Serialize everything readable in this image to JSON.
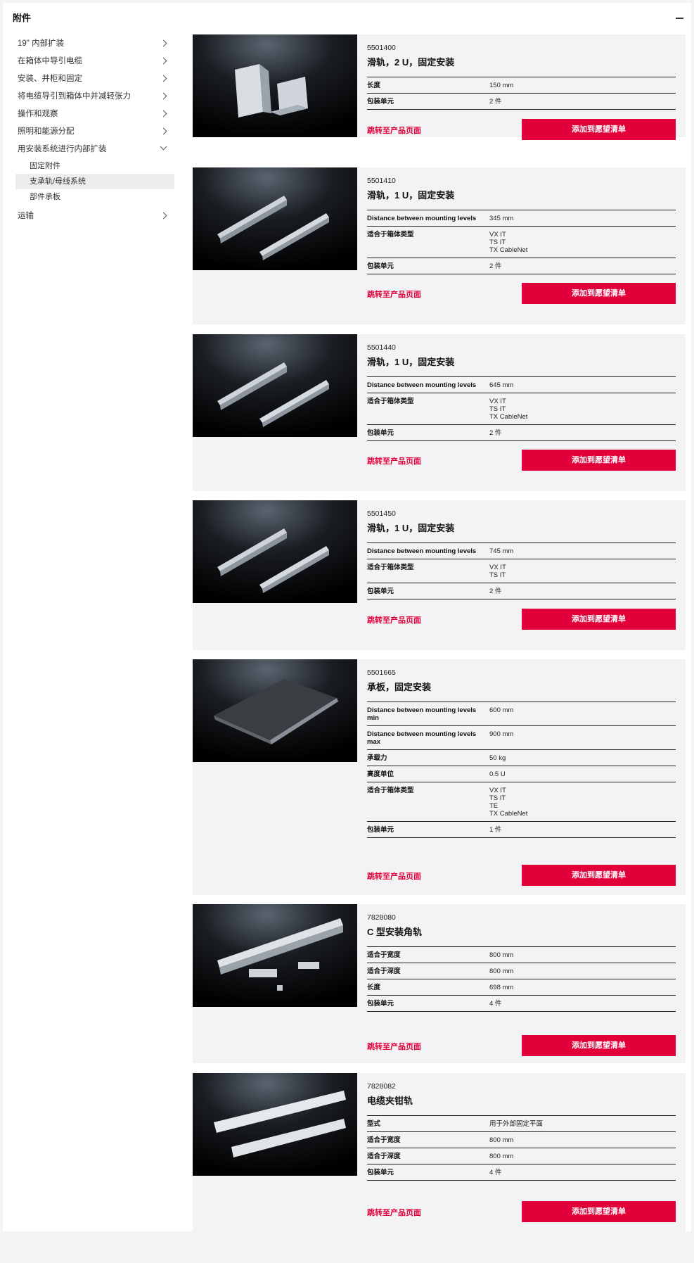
{
  "header": {
    "title": "附件"
  },
  "sidebar": {
    "items": [
      {
        "label": "19\" 内部扩装"
      },
      {
        "label": "在箱体中导引电缆"
      },
      {
        "label": "安装、并柜和固定"
      },
      {
        "label": "将电缆导引到箱体中并减轻张力"
      },
      {
        "label": "操作和观察"
      },
      {
        "label": "照明和能源分配"
      },
      {
        "label": "用安装系统进行内部扩装"
      }
    ],
    "subitems": [
      {
        "label": "固定附件"
      },
      {
        "label": "支承轨/母线系统"
      },
      {
        "label": "部件承板"
      }
    ],
    "last": {
      "label": "运输"
    }
  },
  "actions": {
    "link": "跳转至产品页面",
    "button": "添加到愿望清单"
  },
  "products": [
    {
      "sku": "5501400",
      "name": "滑轨，2 U，固定安装",
      "specs": [
        {
          "k": "长度",
          "v": "150 mm"
        },
        {
          "k": "包装单元",
          "v": "2 件"
        }
      ]
    },
    {
      "sku": "5501410",
      "name": "滑轨，1 U，固定安装",
      "specs": [
        {
          "k": "Distance between mounting levels",
          "v": "345 mm"
        },
        {
          "k": "适合于箱体类型",
          "v": "VX IT\nTS IT\nTX CableNet"
        },
        {
          "k": "包装单元",
          "v": "2 件"
        }
      ]
    },
    {
      "sku": "5501440",
      "name": "滑轨，1 U，固定安装",
      "specs": [
        {
          "k": "Distance between mounting levels",
          "v": "645 mm"
        },
        {
          "k": "适合于箱体类型",
          "v": "VX IT\nTS IT\nTX CableNet"
        },
        {
          "k": "包装单元",
          "v": "2 件"
        }
      ]
    },
    {
      "sku": "5501450",
      "name": "滑轨，1 U，固定安装",
      "specs": [
        {
          "k": "Distance between mounting levels",
          "v": "745 mm"
        },
        {
          "k": "适合于箱体类型",
          "v": "VX IT\nTS IT"
        },
        {
          "k": "包装单元",
          "v": "2 件"
        }
      ]
    },
    {
      "sku": "5501665",
      "name": "承板，固定安装",
      "specs": [
        {
          "k": "Distance between mounting levels min",
          "v": "600 mm"
        },
        {
          "k": "Distance between mounting levels max",
          "v": "900 mm"
        },
        {
          "k": "承载力",
          "v": "50 kg"
        },
        {
          "k": "高度单位",
          "v": "0.5 U"
        },
        {
          "k": "适合于箱体类型",
          "v": "VX IT\nTS IT\nTE\nTX CableNet"
        },
        {
          "k": "包装单元",
          "v": "1 件"
        }
      ]
    },
    {
      "sku": "7828080",
      "name": "C 型安装角轨",
      "specs": [
        {
          "k": "适合于宽度",
          "v": "800 mm"
        },
        {
          "k": "适合于深度",
          "v": "800 mm"
        },
        {
          "k": "长度",
          "v": "698 mm"
        },
        {
          "k": "包装单元",
          "v": "4 件"
        }
      ]
    },
    {
      "sku": "7828082",
      "name": "电缆夹钳轨",
      "specs": [
        {
          "k": "型式",
          "v": "用于外部固定平面"
        },
        {
          "k": "适合于宽度",
          "v": "800 mm"
        },
        {
          "k": "适合于深度",
          "v": "800 mm"
        },
        {
          "k": "包装单元",
          "v": "4 件"
        }
      ]
    }
  ]
}
